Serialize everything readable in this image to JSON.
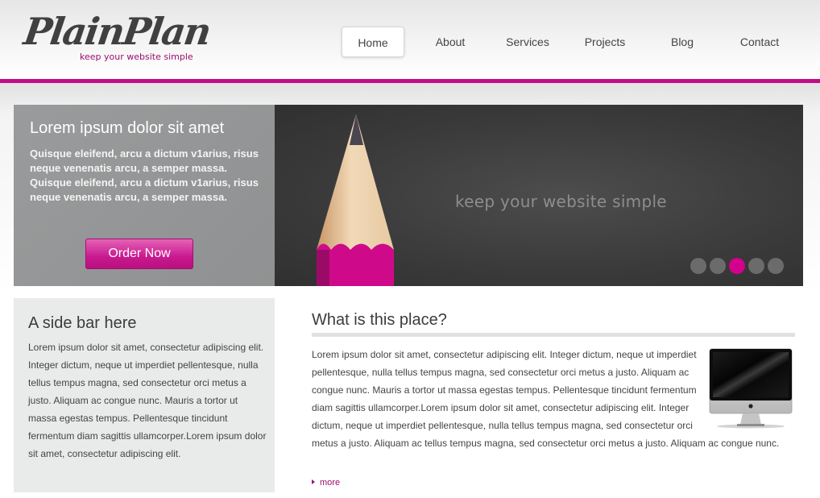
{
  "brand": {
    "logo": "PlainPlan",
    "tagline": "keep your website simple",
    "accent_color": "#c20c86"
  },
  "nav": {
    "items": [
      {
        "label": "Home",
        "active": true
      },
      {
        "label": "About",
        "active": false
      },
      {
        "label": "Services",
        "active": false
      },
      {
        "label": "Projects",
        "active": false
      },
      {
        "label": "Blog",
        "active": false
      },
      {
        "label": "Contact",
        "active": false
      }
    ]
  },
  "intro": {
    "title": "Lorem ipsum dolor sit amet",
    "body": "Quisque eleifend, arcu a dictum v1arius, risus neque venenatis arcu, a semper massa. Quisque eleifend, arcu a dictum v1arius, risus neque venenatis arcu, a semper massa.",
    "button_label": "Order Now"
  },
  "slider": {
    "text": "keep your website simple",
    "image": "pencil-icon",
    "slide_count": 5,
    "active_slide": 3
  },
  "sidebar": {
    "title": "A side bar here",
    "body": "Lorem ipsum dolor sit amet, consectetur adipiscing elit. Integer dictum, neque ut imperdiet pellentesque, nulla tellus tempus magna, sed consectetur orci metus a justo. Aliquam ac congue nunc. Mauris a tortor ut massa egestas tempus. Pellentesque tincidunt fermentum diam sagittis ullamcorper.Lorem ipsum dolor sit amet, consectetur adipiscing elit."
  },
  "main": {
    "title": "What is this place?",
    "body": "Lorem ipsum dolor sit amet, consectetur adipiscing elit. Integer dictum, neque ut imperdiet pellentesque, nulla tellus tempus magna, sed consectetur orci metus a justo. Aliquam ac congue nunc. Mauris a tortor ut massa egestas tempus. Pellentesque tincidunt fermentum diam sagittis ullamcorper.Lorem ipsum dolor sit amet, consectetur adipiscing elit. Integer dictum, neque ut imperdiet pellentesque, nulla tellus tempus magna, sed consectetur orci metus a justo. Aliquam ac tellus tempus magna, sed consectetur orci metus a justo. Aliquam ac congue nunc.",
    "image": "imac-icon",
    "more_label": "more"
  }
}
